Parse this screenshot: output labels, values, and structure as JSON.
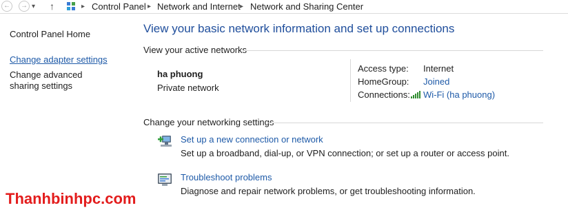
{
  "breadcrumb": {
    "items": [
      "Control Panel",
      "Network and Internet",
      "Network and Sharing Center"
    ]
  },
  "left_pane": {
    "home": "Control Panel Home",
    "adapter": "Change adapter settings",
    "sharing": "Change advanced sharing settings"
  },
  "main": {
    "title": "View your basic network information and set up connections",
    "active_section": "View your active networks",
    "network": {
      "name": "ha phuong",
      "type": "Private network",
      "access_type_label": "Access type:",
      "access_type_value": "Internet",
      "homegroup_label": "HomeGroup:",
      "homegroup_value": "Joined",
      "connections_label": "Connections:",
      "connections_value": "Wi-Fi (ha phuong)"
    },
    "settings_section": "Change your networking settings",
    "tasks": [
      {
        "link": "Set up a new connection or network",
        "desc": "Set up a broadband, dial-up, or VPN connection; or set up a router or access point.",
        "icon": "network-setup-icon"
      },
      {
        "link": "Troubleshoot problems",
        "desc": "Diagnose and repair network problems, or get troubleshooting information.",
        "icon": "troubleshoot-icon"
      }
    ]
  },
  "watermark": "Thanhbinhpc.com",
  "colors": {
    "title_blue": "#1e4d9b",
    "link_blue": "#1e5aa8",
    "watermark_red": "#e31c1c"
  }
}
